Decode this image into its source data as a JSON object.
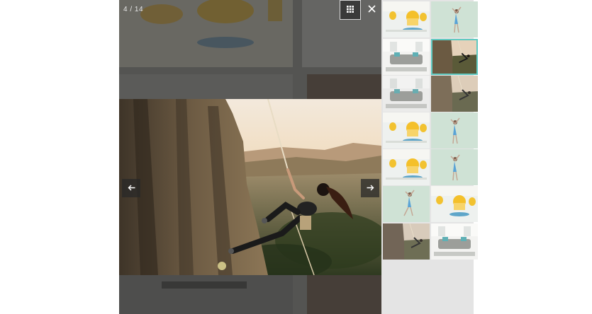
{
  "viewer": {
    "counter": "4 / 14",
    "icons": {
      "grid": "grid-icon",
      "close": "close-icon",
      "prev": "arrow-left-icon",
      "next": "arrow-right-icon"
    },
    "colors": {
      "accent": "#5ec9c0",
      "overlay": "#3a3a3a"
    }
  },
  "thumbnails": [
    {
      "kind": "fruit-glasses"
    },
    {
      "kind": "woman-wall"
    },
    {
      "kind": "sofa-room"
    },
    {
      "kind": "climber",
      "active": true
    },
    {
      "kind": "sofa-room"
    },
    {
      "kind": "climber"
    },
    {
      "kind": "fruit-glasses"
    },
    {
      "kind": "woman-wall"
    },
    {
      "kind": "fruit-glasses"
    },
    {
      "kind": "woman-wall"
    },
    {
      "kind": "woman-wall"
    },
    {
      "kind": "fruit-glasses"
    },
    {
      "kind": "climber"
    },
    {
      "kind": "sofa-room"
    }
  ]
}
